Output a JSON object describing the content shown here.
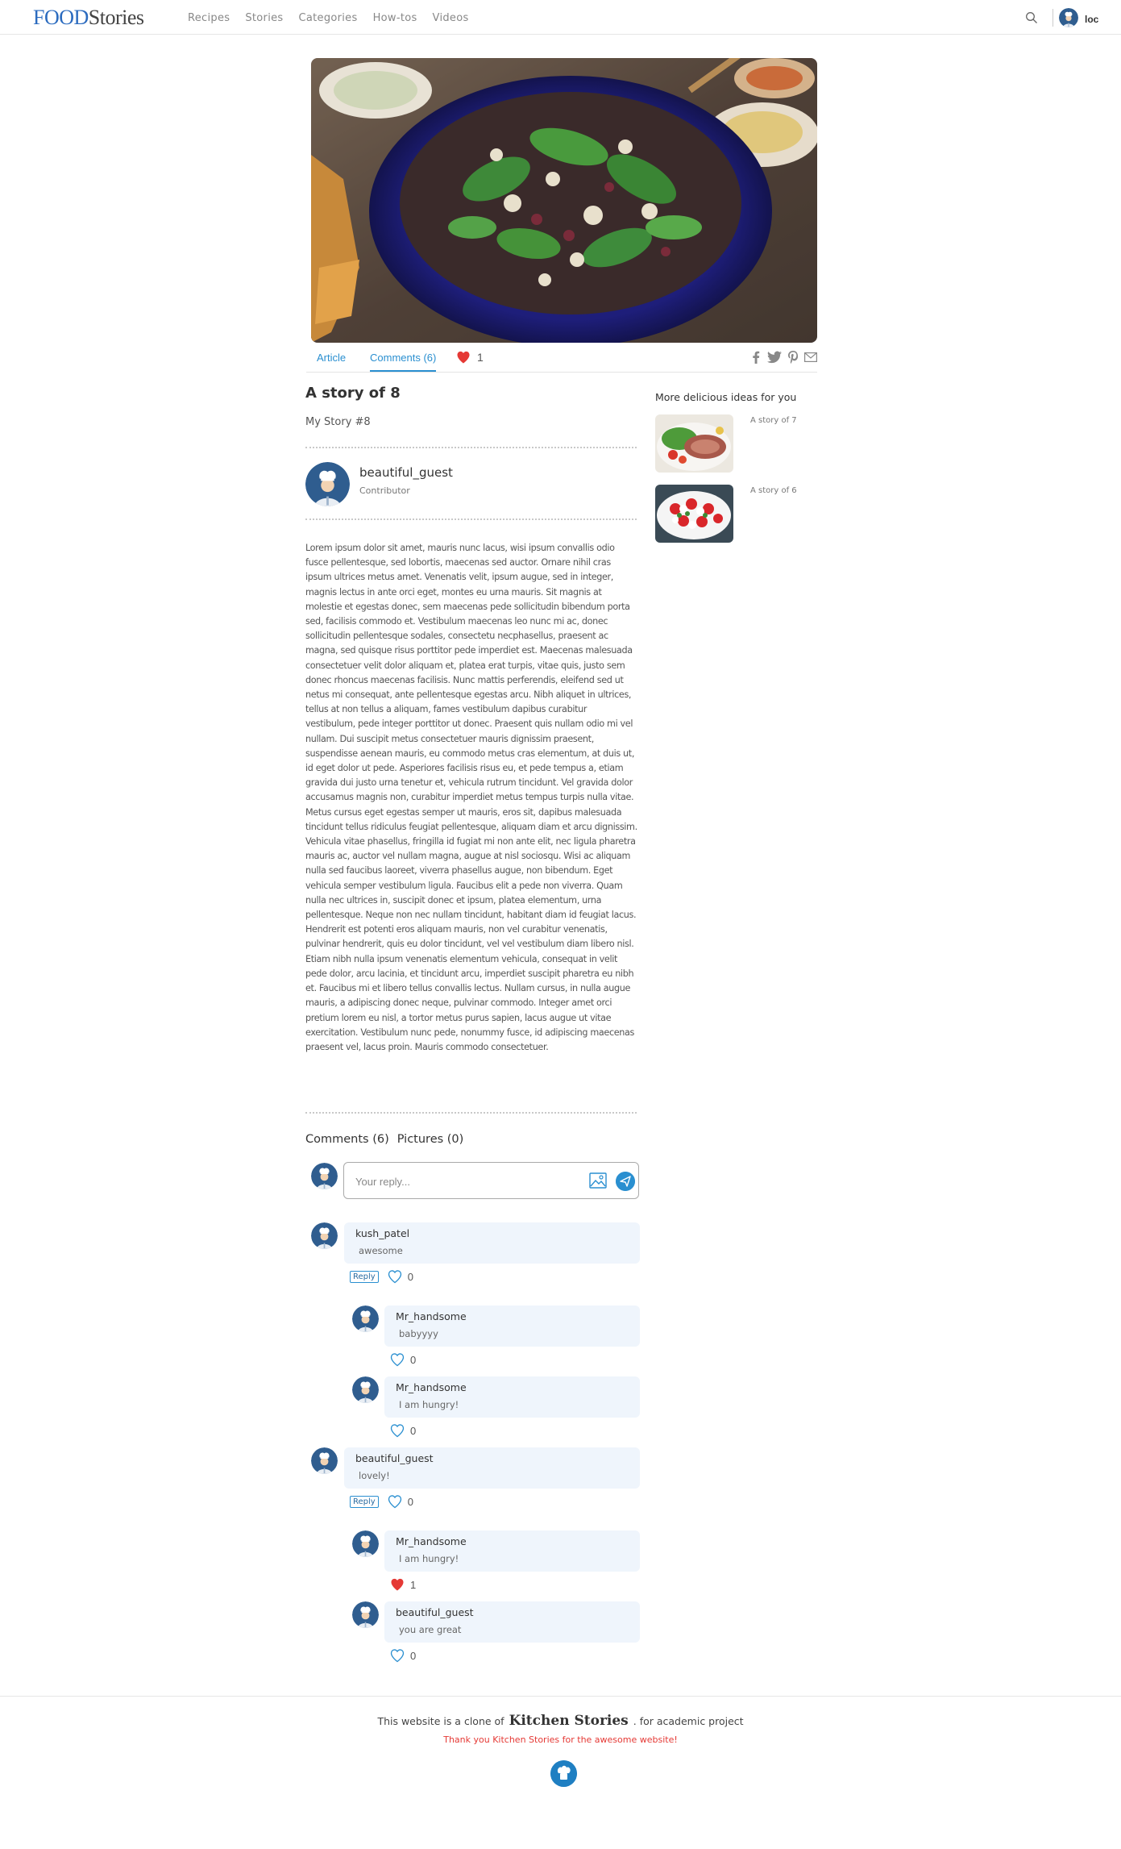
{
  "header": {
    "logo_food": "FOOD",
    "logo_stories": "Stories",
    "nav": [
      "Recipes",
      "Stories",
      "Categories",
      "How-tos",
      "Videos"
    ],
    "user": "loc"
  },
  "tabs": {
    "article": "Article",
    "comments": "Comments (6)",
    "likes": "1"
  },
  "article": {
    "title": "A story of 8",
    "subtitle": "My Story #8",
    "author_name": "beautiful_guest",
    "author_role": "Contributor",
    "body": "Lorem ipsum dolor sit amet, mauris nunc lacus, wisi ipsum convallis odio fusce pellentesque, sed lobortis, maecenas sed auctor. Ornare nihil cras ipsum ultrices metus amet. Venenatis velit, ipsum augue, sed in integer, magnis lectus in ante orci eget, montes eu urna mauris. Sit magnis at molestie et egestas donec, sem maecenas pede sollicitudin bibendum porta sed, facilisis commodo et. Vestibulum maecenas leo nunc mi ac, donec sollicitudin pellentesque sodales, consectetu necphasellus, praesent ac magna, sed quisque risus porttitor pede imperdiet est. Maecenas malesuada consectetuer velit dolor aliquam et, platea erat turpis, vitae quis, justo sem donec rhoncus maecenas facilisis. Nunc mattis perferendis, eleifend sed ut netus mi consequat, ante pellentesque egestas arcu. Nibh aliquet in ultrices, tellus at non tellus a aliquam, fames vestibulum dapibus curabitur vestibulum, pede integer porttitor ut donec. Praesent quis nullam odio mi vel nullam. Dui suscipit metus consectetuer mauris dignissim praesent, suspendisse aenean mauris, eu commodo metus cras elementum, at duis ut, id eget dolor ut pede. Asperiores facilisis risus eu, et pede tempus a, etiam gravida dui justo urna tenetur et, vehicula rutrum tincidunt. Vel gravida dolor accusamus magnis non, curabitur imperdiet metus tempus turpis nulla vitae. Metus cursus eget egestas semper ut mauris, eros sit, dapibus malesuada tincidunt tellus ridiculus feugiat pellentesque, aliquam diam et arcu dignissim. Vehicula vitae phasellus, fringilla id fugiat mi non ante elit, nec ligula pharetra mauris ac, auctor vel nullam magna, augue at nisl sociosqu. Wisi ac aliquam nulla sed faucibus laoreet, viverra phasellus augue, non bibendum. Eget vehicula semper vestibulum ligula. Faucibus elit a pede non viverra. Quam nulla nec ultrices in, suscipit donec et ipsum, platea elementum, urna pellentesque. Neque non nec nullam tincidunt, habitant diam id feugiat lacus. Hendrerit est potenti eros aliquam mauris, non vel curabitur venenatis, pulvinar hendrerit, quis eu dolor tincidunt, vel vel vestibulum diam libero nisl. Etiam nibh nulla ipsum venenatis elementum vehicula, consequat in velit pede dolor, arcu lacinia, et tincidunt arcu, imperdiet suscipit pharetra eu nibh et. Faucibus mi et libero tellus convallis lectus. Nullam cursus, in nulla augue mauris, a adipiscing donec neque, pulvinar commodo. Integer amet orci pretium lorem eu nisl, a tortor metus purus sapien, lacus augue ut vitae exercitation. Vestibulum nunc pede, nonummy fusce, id adipiscing maecenas praesent vel, lacus proin. Mauris commodo consectetuer."
  },
  "sidebar": {
    "title": "More delicious ideas for you",
    "items": [
      {
        "label": "A story of 7"
      },
      {
        "label": "A story of 6"
      }
    ]
  },
  "comments": {
    "comments_tab": "Comments (6)",
    "pictures_tab": "Pictures (0)",
    "reply_placeholder": "Your reply...",
    "reply_label": "Reply",
    "items": [
      {
        "user": "kush_patel",
        "text": "awesome",
        "likes": "0",
        "liked": false
      },
      {
        "user": "Mr_handsome",
        "text": "babyyyy",
        "likes": "0",
        "liked": false
      },
      {
        "user": "Mr_handsome",
        "text": "I am hungry!",
        "likes": "0",
        "liked": false
      },
      {
        "user": "beautiful_guest",
        "text": "lovely!",
        "likes": "0",
        "liked": false
      },
      {
        "user": "Mr_handsome",
        "text": "I am hungry!",
        "likes": "1",
        "liked": true
      },
      {
        "user": "beautiful_guest",
        "text": "you are great",
        "likes": "0",
        "liked": false
      }
    ]
  },
  "footer": {
    "prefix": "This website is a clone of",
    "brand": "Kitchen Stories",
    "suffix": ". for academic project",
    "thanks": "Thank you Kitchen Stories for the awesome website!"
  },
  "colors": {
    "accent": "#2a8fd0",
    "logo_blue": "#2b6bbf",
    "heart_red": "#e53935",
    "comment_bg": "#eff5fc"
  }
}
